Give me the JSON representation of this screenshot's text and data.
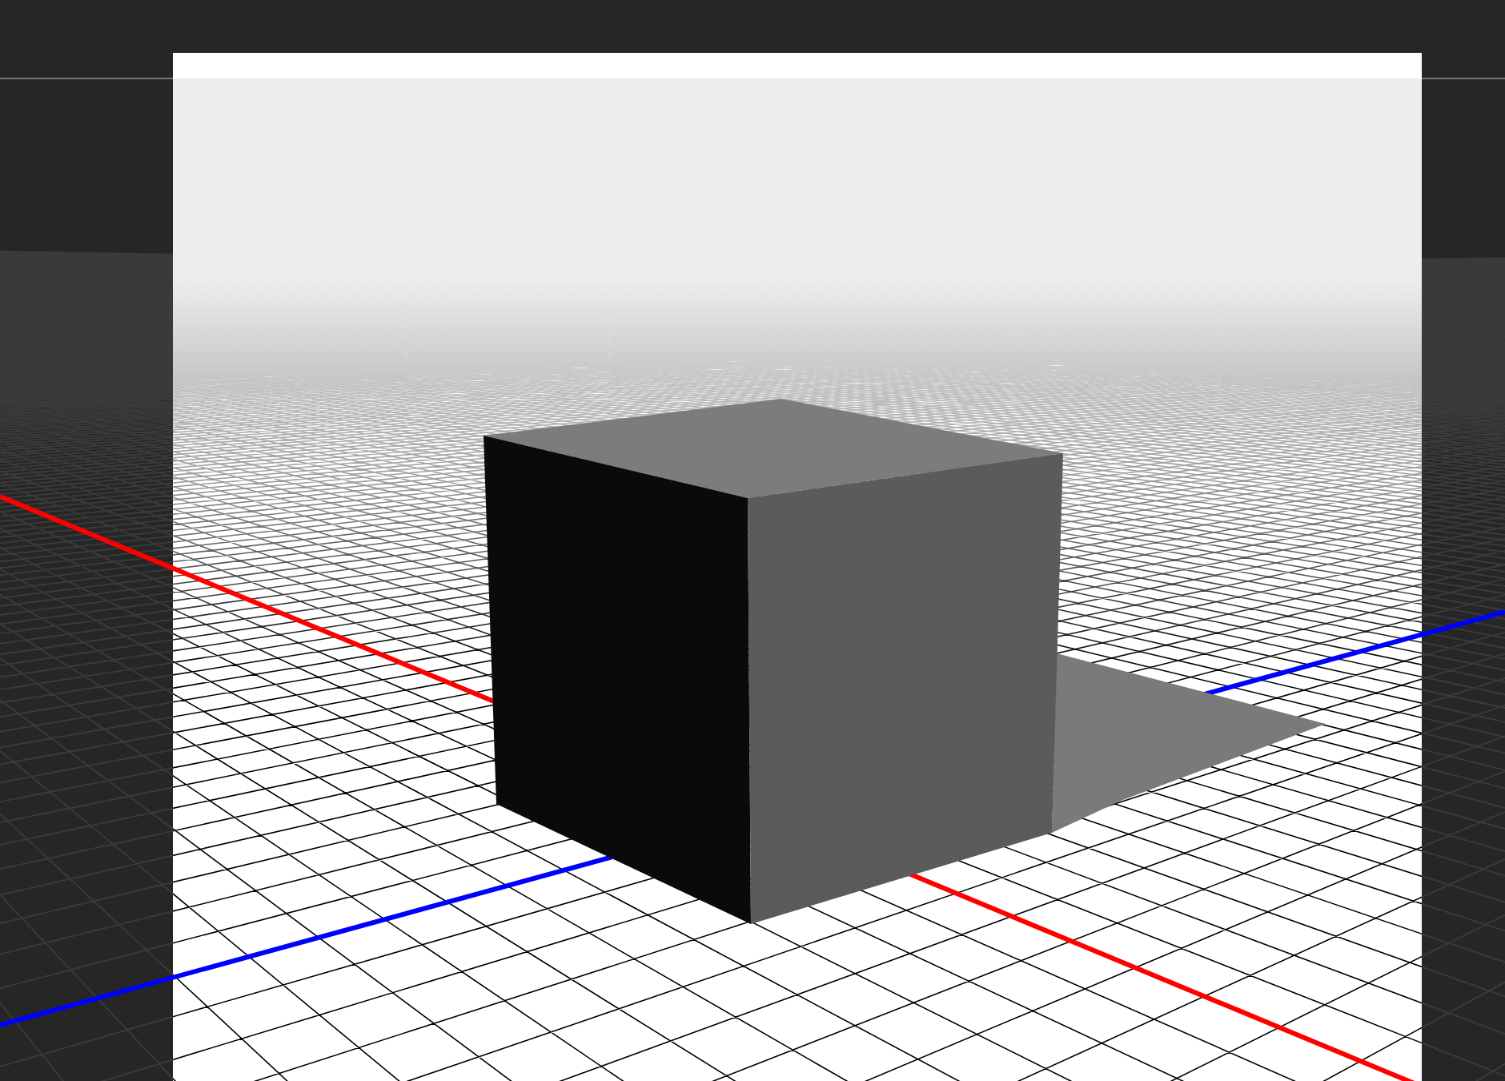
{
  "viewport": {
    "axes": [
      {
        "kind": "x",
        "color": "#ff0000"
      },
      {
        "kind": "z",
        "color": "#0000ff"
      }
    ]
  }
}
